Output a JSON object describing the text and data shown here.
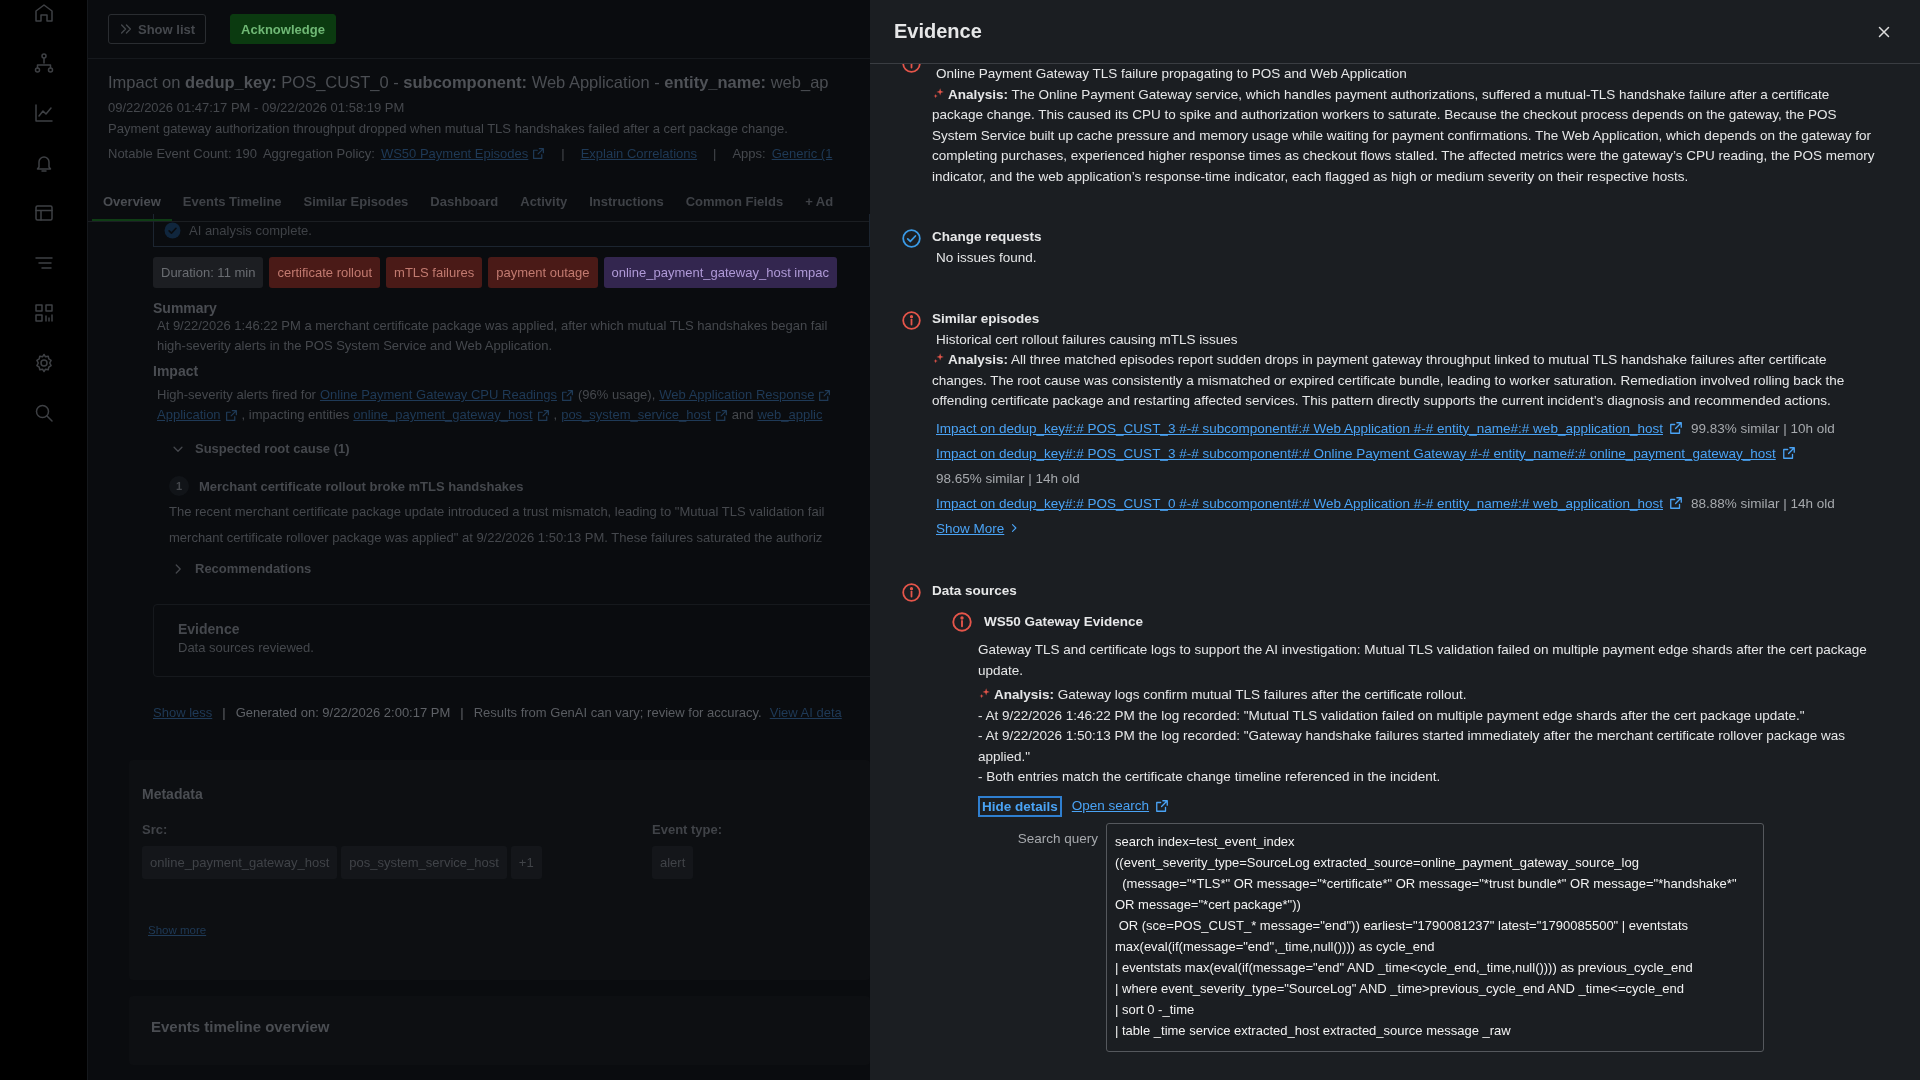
{
  "toolbar": {
    "show_list": "Show list",
    "acknowledge": "Acknowledge"
  },
  "episode": {
    "title": "Impact on **dedup_key:** POS_CUST_0 - **subcomponent:** Web Application - **entity_name:** web_ap",
    "time_range": "09/22/2026 01:47:17 PM - 09/22/2026 01:58:19 PM",
    "description": "Payment gateway authorization throughput dropped when mutual TLS handshakes failed after a cert package change.",
    "meta": [
      {
        "kind": "text",
        "text": "Notable Event Count: 190"
      },
      {
        "kind": "text",
        "text": "Aggregation Policy:"
      },
      {
        "kind": "link",
        "text": "WS50 Payment Episodes",
        "external": true
      },
      {
        "kind": "separator",
        "text": "|"
      },
      {
        "kind": "link",
        "text": "Explain Correlations",
        "external": false
      },
      {
        "kind": "separator",
        "text": "|"
      },
      {
        "kind": "text",
        "text": "Apps:"
      },
      {
        "kind": "link",
        "text": "Generic (1",
        "external": false
      }
    ]
  },
  "tabs": [
    {
      "label": "Overview",
      "selected": true
    },
    {
      "label": "Events Timeline",
      "selected": false
    },
    {
      "label": "Similar Episodes",
      "selected": false
    },
    {
      "label": "Dashboard",
      "selected": false
    },
    {
      "label": "Activity",
      "selected": false
    },
    {
      "label": "Instructions",
      "selected": false
    },
    {
      "label": "Common Fields",
      "selected": false
    },
    {
      "label": "+ Ad",
      "selected": false
    }
  ],
  "overview": {
    "status": "AI analysis complete.",
    "tags": [
      {
        "text": "Duration: 11 min",
        "color": "#1c1e22"
      },
      {
        "text": "certificate rollout",
        "color": "#4a1a17"
      },
      {
        "text": "mTLS failures",
        "color": "#4a1a17"
      },
      {
        "text": "payment outage",
        "color": "#4a1a17"
      },
      {
        "text": "online_payment_gateway_host impac",
        "color": "#33264f"
      }
    ],
    "summary": {
      "heading": "Summary",
      "lines": [
        "At 9/22/2026 1:46:22 PM a merchant certificate package was applied, after which mutual TLS handshakes began fail",
        "high-severity alerts in the POS System Service and Web Application."
      ]
    },
    "impact": {
      "heading": "Impact",
      "lines": [
        [
          {
            "kind": "text",
            "text": "High-severity alerts fired for"
          },
          {
            "kind": "link",
            "text": "Online Payment Gateway CPU Readings"
          },
          {
            "kind": "text",
            "text": "(96% usage),"
          },
          {
            "kind": "link",
            "text": "Web Application Response"
          }
        ],
        [
          {
            "kind": "link",
            "text": "Application"
          },
          {
            "kind": "text",
            "text": ", impacting entities"
          },
          {
            "kind": "link",
            "text": "online_payment_gateway_host"
          },
          {
            "kind": "text",
            "text": ","
          },
          {
            "kind": "link",
            "text": "pos_system_service_host"
          },
          {
            "kind": "text",
            "text": "and"
          },
          {
            "kind": "cut",
            "text": "web_applic"
          }
        ]
      ]
    },
    "root_cause": {
      "label": "Suspected root cause (1)",
      "expanded": true,
      "items": [
        {
          "number": "1",
          "title": "Merchant certificate rollout broke mTLS handshakes",
          "lines": [
            "The recent merchant certificate package update introduced a trust mismatch, leading to \"Mutual TLS validation fail",
            "merchant certificate rollover package was applied\" at 9/22/2026 1:50:13 PM. These failures saturated the authoriz"
          ]
        }
      ]
    },
    "recommendations": {
      "label": "Recommendations",
      "expanded": false
    },
    "evidence_card": {
      "title": "Evidence",
      "text": "Data sources reviewed."
    },
    "footer": [
      {
        "kind": "link",
        "text": "Show less"
      },
      {
        "kind": "separator",
        "text": "|"
      },
      {
        "kind": "muted",
        "text": "Generated on: 9/22/2026 2:00:17 PM"
      },
      {
        "kind": "separator",
        "text": "|"
      },
      {
        "kind": "text",
        "text": "Results from GenAI can vary; review for accuracy."
      },
      {
        "kind": "link",
        "text": "View AI deta"
      }
    ]
  },
  "metadata": {
    "title": "Metadata",
    "fields": [
      {
        "label": "Src:",
        "values": [
          "online_payment_gateway_host",
          "pos_system_service_host",
          "+1"
        ]
      },
      {
        "label": "Event type:",
        "values": [
          "alert"
        ]
      }
    ],
    "show_more": "Show more"
  },
  "timeline": {
    "title": "Events timeline overview"
  },
  "drawer": {
    "title": "Evidence",
    "sections": [
      {
        "kind": "error",
        "summary": "Online Payment Gateway TLS failure propagating to POS and Web Application",
        "analysis": "**Analysis:** The Online Payment Gateway service, which handles payment authorizations, suffered a mutual-TLS handshake failure after a certificate package change. This caused its CPU to spike and authorization workers to saturate. Because the checkout process depends on the gateway, the POS System Service built up cache pressure and memory usage while waiting for payment confirmations. The Web Application, which depends on the gateway for completing purchases, experienced higher response times as checkout flows stalled. The affected metrics were the gateway’s CPU reading, the POS memory indicator, and the web application’s response-time indicator, each flagged as high or medium severity on their respective hosts."
      },
      {
        "kind": "ok",
        "title": "Change requests",
        "summary": "No issues found."
      },
      {
        "kind": "error",
        "title": "Similar episodes",
        "summary": "Historical cert rollout failures causing mTLS issues",
        "analysis": "**Analysis:** All three matched episodes report sudden drops in payment gateway throughput linked to mutual TLS handshake failures after certificate changes. The root cause was consistently a mismatched or expired certificate bundle, leading to worker saturation. Remediation involved rolling back the offending certificate package and restarting affected services. This pattern directly supports the current incident’s diagnosis and recommended actions.",
        "episodes": [
          {
            "link": "Impact on dedup_key#:# POS_CUST_3 #-# subcomponent#:# Web Application #-# entity_name#:# web_application_host",
            "meta": "99.83% similar | 10h old"
          },
          {
            "link": "Impact on dedup_key#:# POS_CUST_3 #-# subcomponent#:# Online Payment Gateway #-# entity_name#:# online_payment_gateway_host",
            "meta": "98.65% similar | 14h old"
          },
          {
            "link": "Impact on dedup_key#:# POS_CUST_0 #-# subcomponent#:# Web Application #-# entity_name#:# web_application_host",
            "meta": "88.88% similar | 14h old"
          }
        ],
        "show_more": "Show More"
      },
      {
        "kind": "error",
        "title": "Data sources",
        "sources": [
          {
            "kind": "error",
            "title": "WS50 Gateway Evidence",
            "description": "Gateway TLS and certificate logs to support the AI investigation: Mutual TLS validation failed on multiple payment edge shards after the cert package update.",
            "analysis": "**Analysis:** Gateway logs confirm mutual TLS failures after the certificate rollout.",
            "details": [
              "- At 9/22/2026 1:46:22 PM the log recorded: \"Mutual TLS validation failed on multiple payment edge shards after the cert package update.\"",
              "- At 9/22/2026 1:50:13 PM the log recorded: \"Gateway handshake failures started immediately after the merchant certificate rollover package was applied.\"",
              "- Both entries match the certificate change timeline referenced in the incident."
            ],
            "hide_details": "Hide details",
            "open_search": "Open search",
            "query_label": "Search query",
            "query": "search index=test_event_index\n((event_severity_type=SourceLog extracted_source=online_payment_gateway_source_log\n  (message=\"*TLS*\" OR message=\"*certificate*\" OR message=\"*trust bundle*\" OR message=\"*handshake*\" OR message=\"*cert package*\"))\n OR (sce=POS_CUST_* message=\"end\")) earliest=\"1790081237\" latest=\"1790085500\" | eventstats max(eval(if(message=\"end\",_time,null()))) as cycle_end\n| eventstats max(eval(if(message=\"end\" AND _time<cycle_end,_time,null()))) as previous_cycle_end\n| where event_severity_type=\"SourceLog\" AND _time>previous_cycle_end AND _time<=cycle_end\n| sort 0 -_time\n| table _time service extracted_host extracted_source message _raw"
          }
        ]
      }
    ]
  }
}
